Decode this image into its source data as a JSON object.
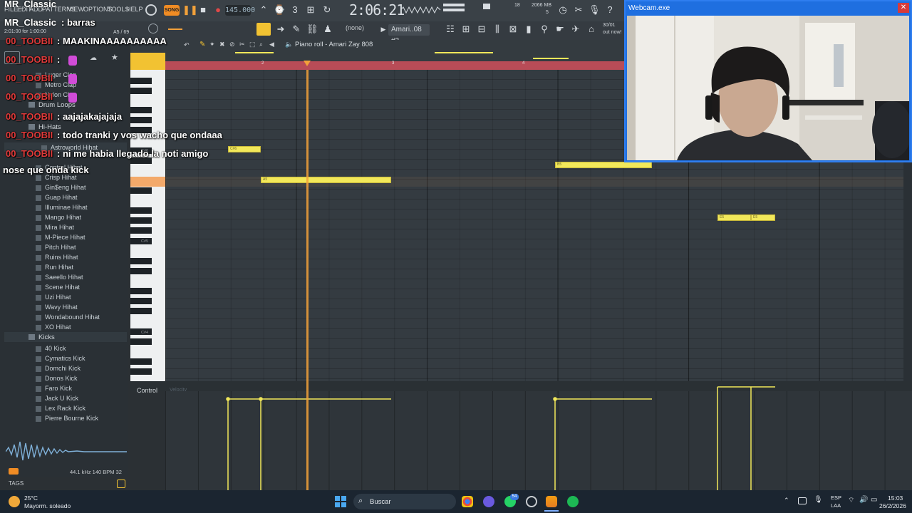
{
  "app": {
    "menu": [
      "FILE",
      "EDIT",
      "ADD",
      "PATTERNS",
      "VIEW",
      "OPTIONS",
      "TOOLS",
      "HELP"
    ],
    "song_mode_label": "SONG",
    "tempo": "145.000",
    "time": "2:06:21",
    "memory": "2066 MB",
    "cpu": "5",
    "poly": "18",
    "hint": "2:01:00 for 1:00:00",
    "hint_right": "30/01",
    "hint_right2": "out now!",
    "position_readout": "A5 / 69",
    "snap": "(none)",
    "pattern": "Amari..08 #2"
  },
  "piano_roll": {
    "title": "Piano roll - Amari Zay 808",
    "timeline": [
      "2",
      "3",
      "4"
    ],
    "key_labels": [
      "C#6",
      "C#5",
      "C#4"
    ],
    "notes": [
      {
        "label": "C#6",
        "color": "#f2e85a"
      },
      {
        "label": "A5",
        "color": "#f2e85a"
      },
      {
        "label": "B5",
        "color": "#f2e85a"
      },
      {
        "label": "E5",
        "color": "#f2e85a"
      },
      {
        "label": "E5",
        "color": "#f2e85a"
      }
    ],
    "control_label": "Control",
    "control_value": "Velocity"
  },
  "browser": {
    "items_top": [
      "Luger Clap",
      "Metro Clap",
      "Nylon Clap"
    ],
    "folder_drum_loops": "Drum Loops",
    "folder_hihats": "Hi-Hats",
    "hihats": [
      "Astroworld Hihat",
      "Control Hihat",
      "Crisp Hihat",
      "Gin$eng Hihat",
      "Guap Hihat",
      "Illuminae Hihat",
      "Mango Hihat",
      "Mira Hihat",
      "M-Piece Hihat",
      "Pitch Hihat",
      "Ruins Hihat",
      "Run Hihat",
      "Saeello Hihat",
      "Scene Hihat",
      "Uzi Hihat",
      "Wavy Hihat",
      "Wondabound Hihat",
      "XO Hihat"
    ],
    "folder_kicks": "Kicks",
    "kicks": [
      "40 Kick",
      "Cymatics Kick",
      "Domchi Kick",
      "Donos Kick",
      "Faro Kick",
      "Jack U Kick",
      "Lex Rack Kick",
      "Pierre Bourne Kick"
    ],
    "sample_info": "44.1 kHz 140 BPM 32",
    "tags_label": "TAGS"
  },
  "webcam": {
    "title": "Webcam.exe"
  },
  "chat": [
    {
      "name": "MR_Classic",
      "text": ": barras"
    },
    {
      "name": "00_TOOBII",
      "text": ": MAAKINAAAAAAAAAA"
    },
    {
      "name": "00_TOOBII",
      "text": ":"
    },
    {
      "name": "00_TOOBII",
      "text": ""
    },
    {
      "name": "00_TOOBII",
      "text": ""
    },
    {
      "name": "00_TOOBII",
      "text": ": aajajakajajaja"
    },
    {
      "name": "00_TOOBII",
      "text": ": todo tranki y vos wacho que ondaaa"
    },
    {
      "name": "00_TOOBII",
      "text": ": ni me habia llegado la noti amigo"
    },
    {
      "name": "",
      "text": "nose que onda kick"
    }
  ],
  "taskbar": {
    "weather_temp": "25°C",
    "weather_desc": "Mayorm. soleado",
    "search_placeholder": "Buscar",
    "lang": "ESP",
    "lang2": "LAA",
    "clock_time": "15:03",
    "clock_date": "26/2/2026",
    "badge": "54"
  },
  "colors": {
    "accent": "#f2c232",
    "note": "#f2e85a",
    "timeline": "#b84c57",
    "playhead": "#f2a13a",
    "webcam_border": "#1f6fe0",
    "chat_name": "#e03a3a"
  }
}
